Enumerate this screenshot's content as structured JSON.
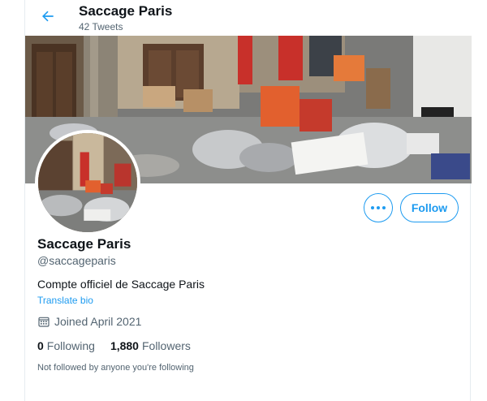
{
  "header": {
    "title": "Saccage Paris",
    "tweet_count": "42 Tweets"
  },
  "profile": {
    "name": "Saccage Paris",
    "handle": "@saccageparis",
    "bio": "Compte officiel de Saccage Paris",
    "translate_label": "Translate bio",
    "joined": "Joined April 2021",
    "following_count": "0",
    "following_label": "Following",
    "followers_count": "1,880",
    "followers_label": "Followers",
    "not_followed_note": "Not followed by anyone you're following"
  },
  "actions": {
    "follow_label": "Follow",
    "more_icon": "more-icon"
  },
  "colors": {
    "accent": "#1d9bf0",
    "text": "#0f1419",
    "muted": "#536471"
  }
}
